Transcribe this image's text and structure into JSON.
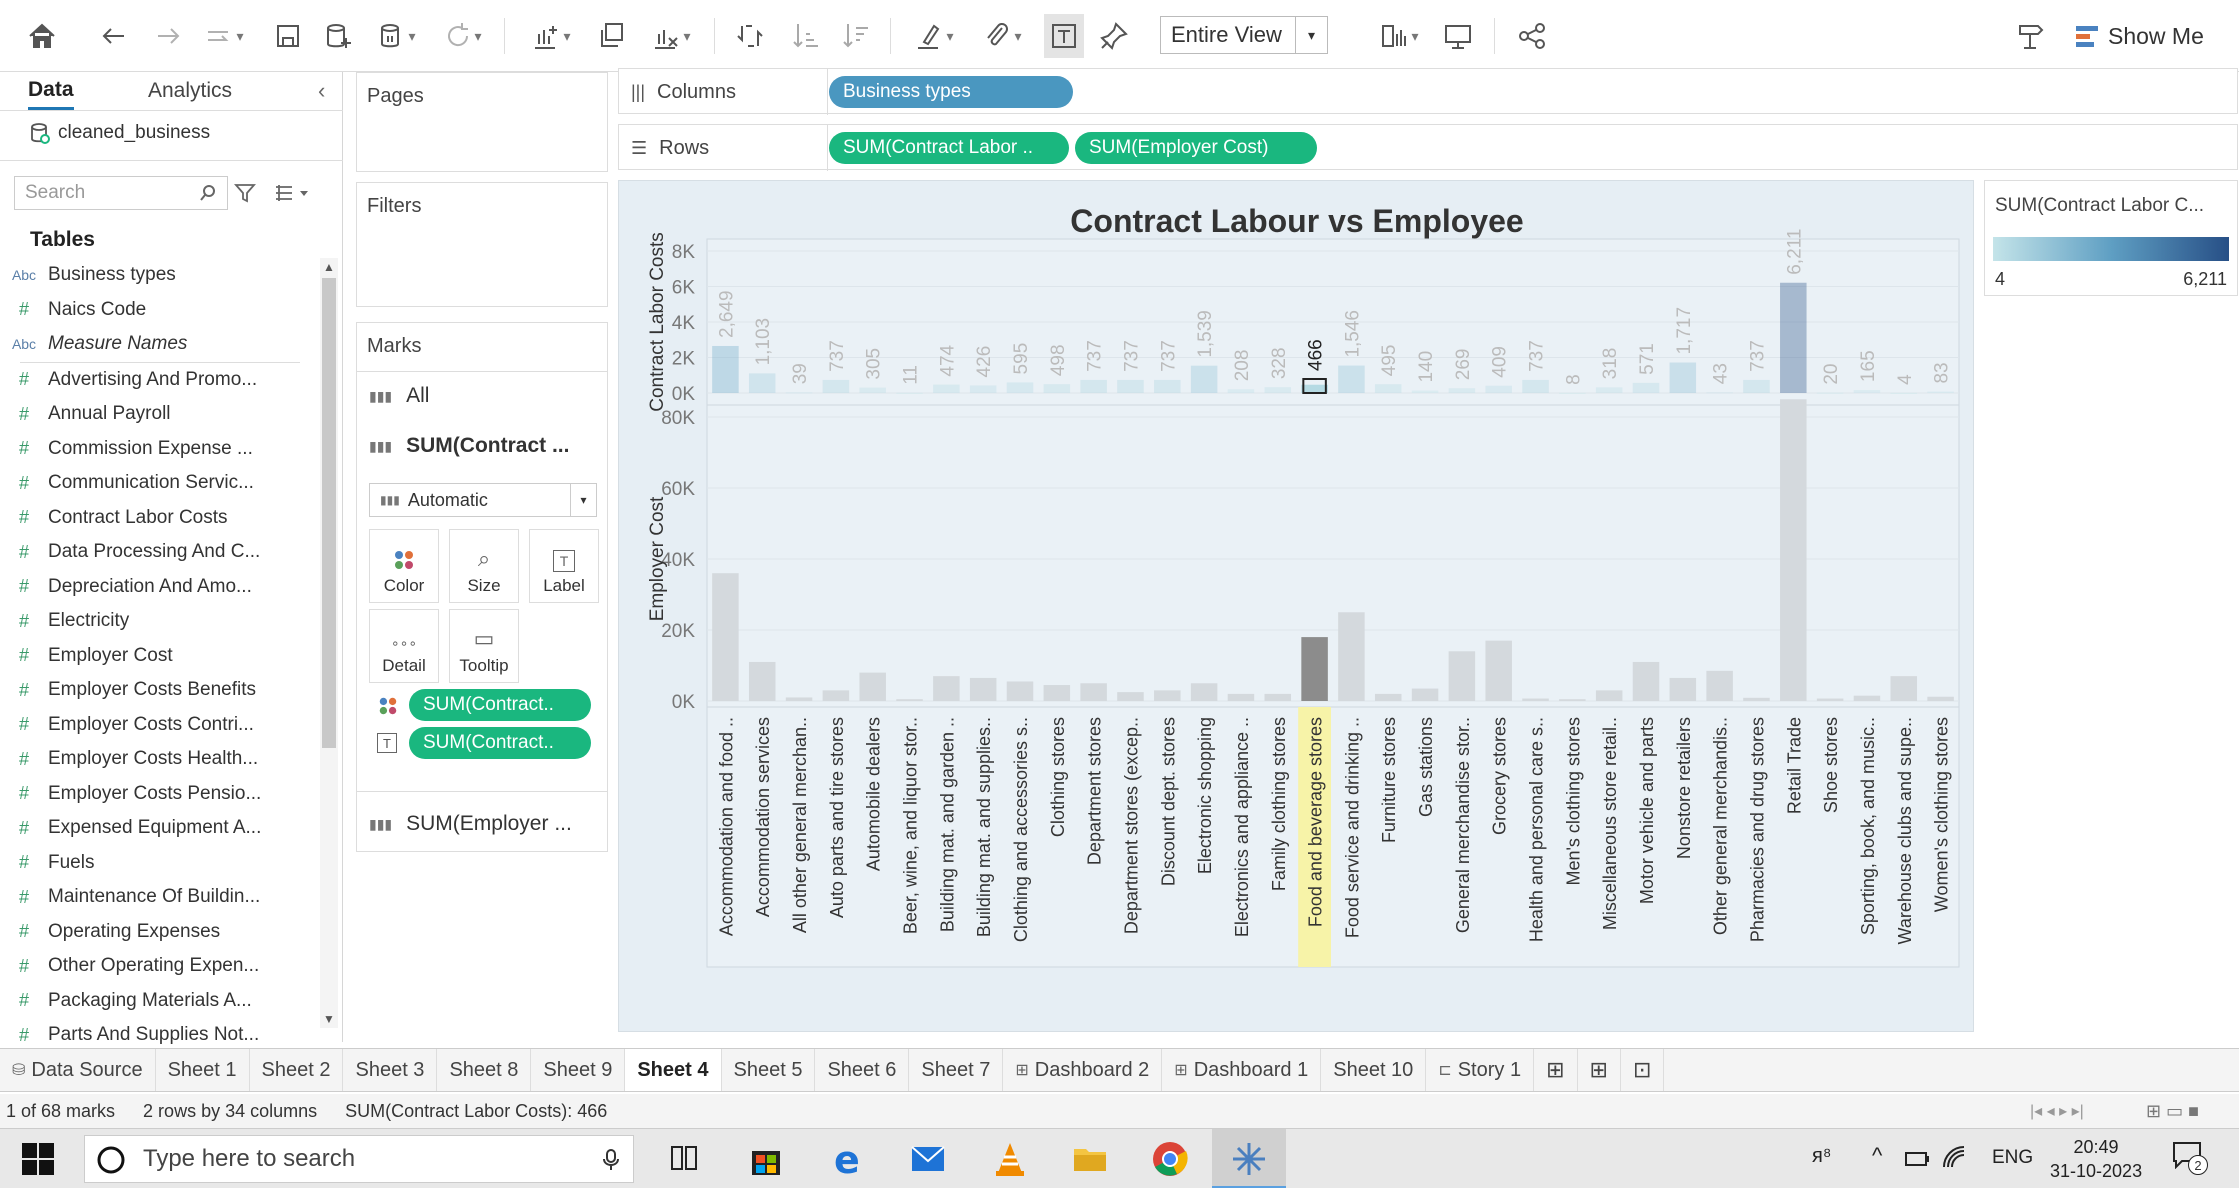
{
  "toolbar": {
    "view_mode": "Entire View",
    "show_me_label": "Show Me"
  },
  "data_pane": {
    "tab_data": "Data",
    "tab_analytics": "Analytics",
    "datasource": "cleaned_business",
    "search_placeholder": "Search",
    "tables_label": "Tables",
    "fields": [
      {
        "type": "Abc",
        "name": "Business types",
        "italic": false
      },
      {
        "type": "#",
        "name": "Naics Code",
        "italic": false
      },
      {
        "type": "Abc",
        "name": "Measure Names",
        "italic": true
      },
      {
        "type": "#",
        "name": "Advertising And Promo...",
        "italic": false
      },
      {
        "type": "#",
        "name": "Annual Payroll",
        "italic": false
      },
      {
        "type": "#",
        "name": "Commission Expense ...",
        "italic": false
      },
      {
        "type": "#",
        "name": "Communication Servic...",
        "italic": false
      },
      {
        "type": "#",
        "name": "Contract Labor Costs",
        "italic": false
      },
      {
        "type": "#",
        "name": "Data Processing And C...",
        "italic": false
      },
      {
        "type": "#",
        "name": "Depreciation And Amo...",
        "italic": false
      },
      {
        "type": "#",
        "name": "Electricity",
        "italic": false
      },
      {
        "type": "#",
        "name": "Employer Cost",
        "italic": false
      },
      {
        "type": "#",
        "name": "Employer Costs Benefits",
        "italic": false
      },
      {
        "type": "#",
        "name": "Employer Costs Contri...",
        "italic": false
      },
      {
        "type": "#",
        "name": "Employer Costs Health...",
        "italic": false
      },
      {
        "type": "#",
        "name": "Employer Costs Pensio...",
        "italic": false
      },
      {
        "type": "#",
        "name": "Expensed Equipment A...",
        "italic": false
      },
      {
        "type": "#",
        "name": "Fuels",
        "italic": false
      },
      {
        "type": "#",
        "name": "Maintenance Of Buildin...",
        "italic": false
      },
      {
        "type": "#",
        "name": "Operating Expenses",
        "italic": false
      },
      {
        "type": "#",
        "name": "Other Operating Expen...",
        "italic": false
      },
      {
        "type": "#",
        "name": "Packaging Materials A...",
        "italic": false
      },
      {
        "type": "#",
        "name": "Parts And Supplies Not...",
        "italic": false
      }
    ]
  },
  "pages_card": {
    "title": "Pages"
  },
  "filters_card": {
    "title": "Filters"
  },
  "marks_card": {
    "title": "Marks",
    "all_label": "All",
    "sum_contract_label": "SUM(Contract ...",
    "mark_type": "Automatic",
    "btn_color": "Color",
    "btn_size": "Size",
    "btn_label": "Label",
    "btn_detail": "Detail",
    "btn_tooltip": "Tooltip",
    "pill_color": "SUM(Contract..",
    "pill_label": "SUM(Contract..",
    "sum_employer_label": "SUM(Employer ..."
  },
  "shelves": {
    "columns_label": "Columns",
    "columns_pill": "Business types",
    "rows_label": "Rows",
    "rows_pill_1": "SUM(Contract Labor ..",
    "rows_pill_2": "SUM(Employer Cost)"
  },
  "legend": {
    "title": "SUM(Contract Labor C...",
    "min": "4",
    "max": "6,211"
  },
  "tabs": [
    {
      "label": "Data Source",
      "icon": "db",
      "active": false
    },
    {
      "label": "Sheet 1",
      "icon": "",
      "active": false
    },
    {
      "label": "Sheet 2",
      "icon": "",
      "active": false
    },
    {
      "label": "Sheet 3",
      "icon": "",
      "active": false
    },
    {
      "label": "Sheet 8",
      "icon": "",
      "active": false
    },
    {
      "label": "Sheet 9",
      "icon": "",
      "active": false
    },
    {
      "label": "Sheet 4",
      "icon": "",
      "active": true
    },
    {
      "label": "Sheet 5",
      "icon": "",
      "active": false
    },
    {
      "label": "Sheet 6",
      "icon": "",
      "active": false
    },
    {
      "label": "Sheet 7",
      "icon": "",
      "active": false
    },
    {
      "label": "Dashboard 2",
      "icon": "dash",
      "active": false
    },
    {
      "label": "Dashboard 1",
      "icon": "dash",
      "active": false
    },
    {
      "label": "Sheet 10",
      "icon": "",
      "active": false
    },
    {
      "label": "Story 1",
      "icon": "story",
      "active": false
    }
  ],
  "status": {
    "marks": "1 of 68 marks",
    "dims": "2 rows by 34 columns",
    "sum": "SUM(Contract Labor Costs): 466"
  },
  "taskbar": {
    "search_placeholder": "Type here to search",
    "lang": "ENG",
    "time": "20:49",
    "date": "31-10-2023",
    "notifications": "2"
  },
  "chart_data": {
    "type": "bar",
    "title": "Contract Labour vs Employee",
    "categories": [
      "Accommodation and food ..",
      "Accommodation services",
      "All other general merchan..",
      "Auto parts and tire stores",
      "Automobile dealers",
      "Beer, wine, and liquor stor..",
      "Building mat. and garden ..",
      "Building mat. and supplies..",
      "Clothing and accessories s..",
      "Clothing stores",
      "Department stores",
      "Department stores (excep..",
      "Discount dept. stores",
      "Electronic shopping",
      "Electronics and appliance ..",
      "Family clothing stores",
      "Food and beverage stores",
      "Food service and drinking ..",
      "Furniture stores",
      "Gas stations",
      "General merchandise stor..",
      "Grocery stores",
      "Health and personal care s..",
      "Men's clothing stores",
      "Miscellaneous store retail..",
      "Motor vehicle and parts",
      "Nonstore retailers",
      "Other general merchandis..",
      "Pharmacies and drug stores",
      "Retail Trade",
      "Shoe stores",
      "Sporting, book, and music..",
      "Warehouse clubs and supe..",
      "Women's clothing stores"
    ],
    "series": [
      {
        "name": "Contract Labor Costs",
        "axis_label": "Contract Labor Costs",
        "ticks": [
          "0K",
          "2K",
          "4K",
          "6K",
          "8K"
        ],
        "ylim": [
          0,
          8000
        ],
        "values": [
          2649,
          1103,
          39,
          737,
          305,
          11,
          474,
          426,
          595,
          498,
          737,
          737,
          737,
          1539,
          208,
          328,
          466,
          1546,
          495,
          140,
          269,
          409,
          737,
          8,
          318,
          571,
          1717,
          43,
          737,
          6211,
          20,
          165,
          4,
          83
        ],
        "labels": [
          "2,649",
          "1,103",
          "39",
          "737",
          "305",
          "11",
          "474",
          "426",
          "595",
          "498",
          "737",
          "737",
          "737",
          "1,539",
          "208",
          "328",
          "466",
          "1,546",
          "495",
          "140",
          "269",
          "409",
          "737",
          "8",
          "318",
          "571",
          "1,717",
          "43",
          "737",
          "6,211",
          "20",
          "165",
          "4",
          "83"
        ]
      },
      {
        "name": "Employer Cost",
        "axis_label": "Employer Cost",
        "ticks": [
          "0K",
          "20K",
          "40K",
          "60K",
          "80K"
        ],
        "ylim": [
          0,
          80000
        ],
        "values": [
          36000,
          11000,
          1000,
          3000,
          8000,
          500,
          7000,
          6500,
          5500,
          4500,
          5000,
          2500,
          3000,
          5000,
          2000,
          2000,
          18000,
          25000,
          2000,
          3500,
          14000,
          17000,
          700,
          500,
          3000,
          11000,
          6500,
          8500,
          900,
          85000,
          700,
          1500,
          7000,
          1200
        ]
      }
    ],
    "selected_index": 16,
    "color_scale": {
      "low": "#c4e4e9",
      "mid": "#5f9fc3",
      "high": "#274f86",
      "min": 4,
      "max": 6211
    }
  }
}
